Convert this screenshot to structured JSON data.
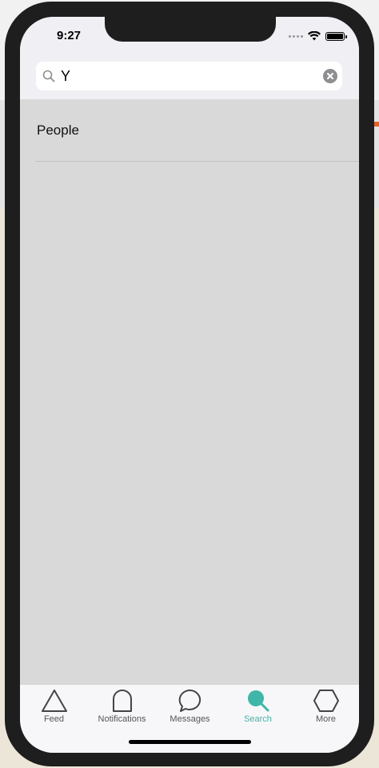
{
  "status_bar": {
    "time": "9:27"
  },
  "search": {
    "value": "Y"
  },
  "results": {
    "section_title": "People"
  },
  "tab_bar": {
    "active_color": "#3eb7a8",
    "tabs": [
      {
        "label": "Feed",
        "icon": "triangle-icon"
      },
      {
        "label": "Notifications",
        "icon": "bell-arch-icon"
      },
      {
        "label": "Messages",
        "icon": "speech-bubble-icon"
      },
      {
        "label": "Search",
        "icon": "search-icon",
        "active": true
      },
      {
        "label": "More",
        "icon": "hexagon-icon"
      }
    ]
  }
}
